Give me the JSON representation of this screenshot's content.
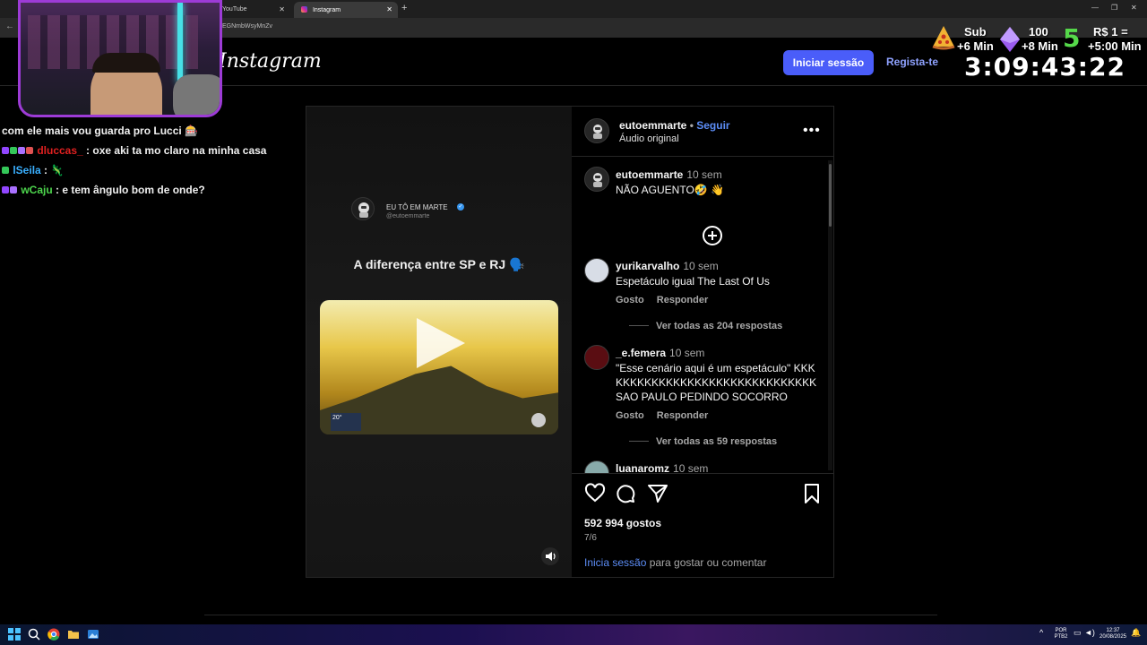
{
  "browser": {
    "tabs": [
      {
        "label": "YouTube",
        "active": false
      },
      {
        "label": "Instagram",
        "active": true
      }
    ],
    "new_tab": "+",
    "url": "EGNmbWsyMnZv"
  },
  "instagram": {
    "logo": "Instagram",
    "login_button": "Iniciar sessão",
    "register_link": "Regista-te",
    "accent_color": "#4a5df9"
  },
  "overlay": {
    "sub_label": "Sub",
    "sub_time": "+6 Min",
    "eth_count": "100",
    "eth_time": "+8 Min",
    "money_label": "R$ 1 =",
    "money_time": "+5:00 Min",
    "timer": "3:09:43:22"
  },
  "chat": [
    {
      "user": "",
      "sep": "",
      "message": "com ele mais vou guarda pro Lucci 🎰"
    },
    {
      "user": "dluccas_",
      "sep": " : ",
      "message": "oxe aki ta mo claro na minha casa"
    },
    {
      "user": "lSeila",
      "sep": " : ",
      "message": "🦎"
    },
    {
      "user": "wCaju",
      "sep": " : ",
      "message": "e tem ângulo bom de onde?"
    }
  ],
  "post": {
    "media": {
      "name": "EU TÔ EM MARTE",
      "handle": "@eutoemmarte",
      "title": "A diferença entre SP e RJ 🗣️",
      "weather_temp": "20°"
    },
    "author": "eutoemmarte",
    "dot": "•",
    "follow": "Seguir",
    "audio": "Áudio original",
    "caption": {
      "user": "eutoemmarte",
      "time": "10 sem",
      "text": "NÃO AGUENTO🤣 👋"
    },
    "comments": [
      {
        "user": "yurikarvalho",
        "time": "10 sem",
        "text": "Espetáculo igual The Last Of Us",
        "like": "Gosto",
        "reply": "Responder",
        "replies": "Ver todas as 204 respostas"
      },
      {
        "user": "_e.femera",
        "time": "10 sem",
        "text": "\"Esse cenário aqui é um espetáculo\" KKKKKKKKKKKKKKKKKKKKKKKKKKKKKKK SAO PAULO PEDINDO SOCORRO",
        "like": "Gosto",
        "reply": "Responder",
        "replies": "Ver todas as 59 respostas"
      },
      {
        "user": "luanaromz",
        "time": "10 sem",
        "text": ""
      }
    ],
    "likes": "592 994 gostos",
    "date": "7/6",
    "login_link": "Inicia sessão",
    "login_rest": " para gostar ou comentar"
  },
  "taskbar": {
    "lang": "POR\nPTB2",
    "time": "12:37",
    "date": "20/08/2025"
  }
}
